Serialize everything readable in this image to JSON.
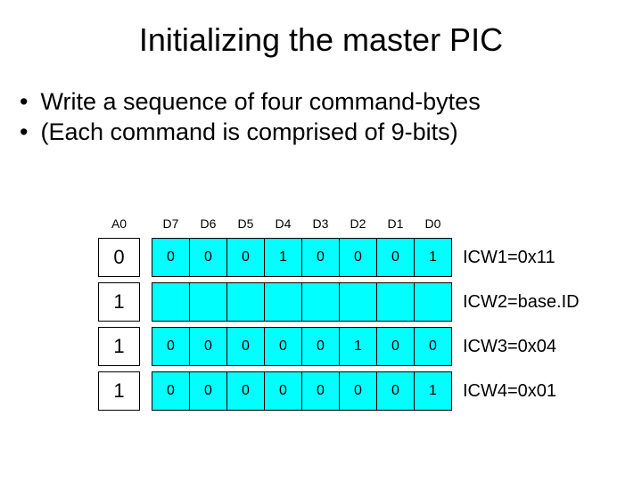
{
  "title": "Initializing the master PIC",
  "bullets": [
    "Write a sequence of four command-bytes",
    "(Each command is comprised of 9-bits)"
  ],
  "table": {
    "columns": [
      "A0",
      "D7",
      "D6",
      "D5",
      "D4",
      "D3",
      "D2",
      "D1",
      "D0"
    ],
    "rows": [
      {
        "a0": "0",
        "bits": [
          "0",
          "0",
          "0",
          "1",
          "0",
          "0",
          "0",
          "1"
        ],
        "label": "ICW1=0x11"
      },
      {
        "a0": "1",
        "bits": [
          "",
          "",
          "",
          "",
          "",
          "",
          "",
          ""
        ],
        "label": "ICW2=base.ID"
      },
      {
        "a0": "1",
        "bits": [
          "0",
          "0",
          "0",
          "0",
          "0",
          "1",
          "0",
          "0"
        ],
        "label": "ICW3=0x04"
      },
      {
        "a0": "1",
        "bits": [
          "0",
          "0",
          "0",
          "0",
          "0",
          "0",
          "0",
          "1"
        ],
        "label": "ICW4=0x01"
      }
    ]
  }
}
